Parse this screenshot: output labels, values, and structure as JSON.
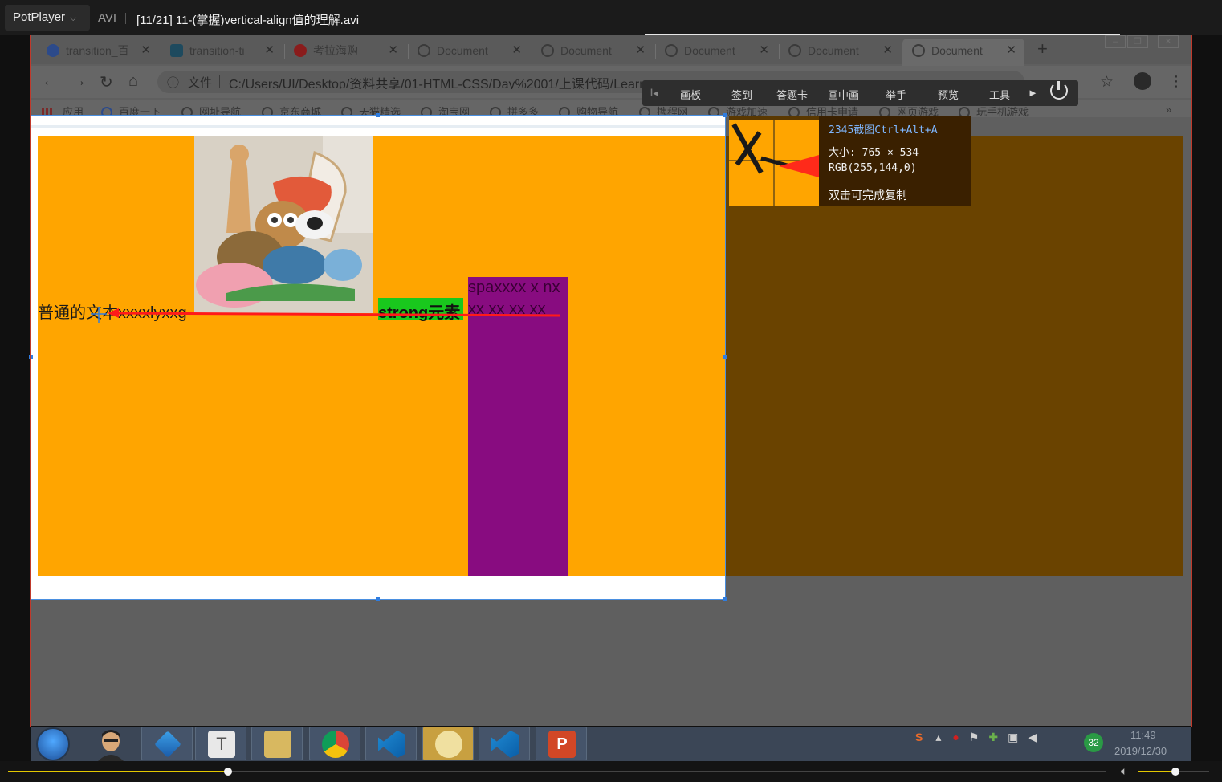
{
  "player": {
    "app_name": "PotPlayer",
    "format": "AVI",
    "title": "[11/21] 11-(掌握)vertical-align值的理解.avi",
    "progress": 0.2,
    "volume": 0.52
  },
  "browser": {
    "tabs": [
      {
        "label": "transition_百",
        "icon": "paw-icon"
      },
      {
        "label": "transition-ti",
        "icon": "bird-icon"
      },
      {
        "label": "考拉海购",
        "icon": "koala-icon"
      },
      {
        "label": "Document",
        "icon": "globe-icon"
      },
      {
        "label": "Document",
        "icon": "globe-icon"
      },
      {
        "label": "Document",
        "icon": "globe-icon"
      },
      {
        "label": "Document",
        "icon": "globe-icon"
      },
      {
        "label": "Document",
        "icon": "globe-icon",
        "active": true
      }
    ],
    "new_tab": "+",
    "url_file_label": "文件",
    "url": "C:/Users/UI/Desktop/资料共享/01-HTML-CSS/Day%2001/上课代码/Learn",
    "bookmarks": [
      "应用",
      "百度一下",
      "网址导航",
      "京东商城",
      "天猫精选",
      "淘宝网",
      "拼多多",
      "购物导航",
      "携程网",
      "游戏加速",
      "信用卡申请",
      "网页游戏",
      "玩手机游戏"
    ],
    "bookmarks_more": "»"
  },
  "floating_toolbar": {
    "items": [
      "画板",
      "签到",
      "答题卡",
      "画中画",
      "举手",
      "预览",
      "工具"
    ]
  },
  "page": {
    "normal_text": "普通的文本xxxxlyxxg",
    "strong_text": "strong元素",
    "span_line1": "spaxxxx x nx",
    "span_line2": "xx xx xx xx",
    "colors": {
      "orange": "#ffa500",
      "purple": "#880c80",
      "green": "#19c81d"
    }
  },
  "capture_tool": {
    "title": "2345截图Ctrl+Alt+A",
    "size_label": "大小: 765 × 534",
    "rgb_label": "RGB(255,144,0)",
    "hint": "双击可完成复制"
  },
  "taskbar": {
    "apps": [
      "start-orb",
      "avatar",
      "kuaibo",
      "typora",
      "explorer",
      "chrome",
      "vscode",
      "notepad",
      "vscode",
      "powerpoint"
    ],
    "tray_badge": "32",
    "time": "11:49",
    "date": "2019/12/30"
  }
}
